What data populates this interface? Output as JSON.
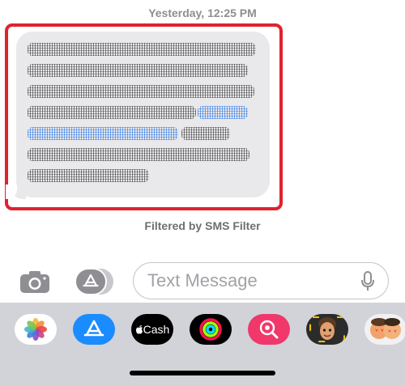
{
  "conversation": {
    "timestamp": "Yesterday, 12:25 PM",
    "filter_note": "Filtered by SMS Filter"
  },
  "composer": {
    "placeholder": "Text Message"
  },
  "apps": {
    "cash_label": "Cash"
  },
  "colors": {
    "highlight": "#e0222d",
    "bubble": "#e9e9eb",
    "drawer": "#d1d3d9"
  },
  "icons": [
    "camera-icon",
    "app-store-icon",
    "microphone-icon",
    "photos-icon",
    "apple-cash-icon",
    "activity-icon",
    "search-heart-icon",
    "memoji-icon"
  ]
}
